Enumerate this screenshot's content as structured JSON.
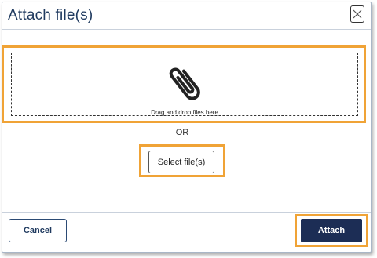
{
  "dialog": {
    "title": "Attach file(s)",
    "close_icon": "close-icon"
  },
  "drop_zone": {
    "icon": "paperclip-icon",
    "label": "Drag and drop files here"
  },
  "or_label": "OR",
  "select_button": {
    "label": "Select file(s)"
  },
  "footer": {
    "cancel_label": "Cancel",
    "attach_label": "Attach"
  },
  "colors": {
    "highlight": "#f0a336",
    "primary": "#1c2d55",
    "title": "#1f3a5f"
  }
}
